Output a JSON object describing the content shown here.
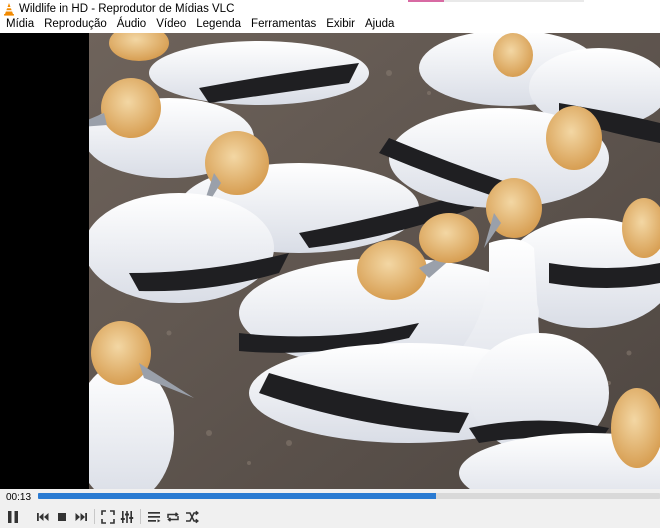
{
  "window": {
    "title": "Wildlife in HD - Reprodutor de Mídias VLC",
    "icon": "vlc-cone-icon"
  },
  "menu": [
    {
      "label": "Mídia"
    },
    {
      "label": "Reprodução"
    },
    {
      "label": "Áudio"
    },
    {
      "label": "Vídeo"
    },
    {
      "label": "Legenda"
    },
    {
      "label": "Ferramentas"
    },
    {
      "label": "Exibir"
    },
    {
      "label": "Ajuda"
    }
  ],
  "player": {
    "elapsed": "00:13",
    "progress_percent": 64
  },
  "controls": [
    {
      "name": "pause-icon"
    },
    {
      "name": "previous-icon"
    },
    {
      "name": "stop-icon"
    },
    {
      "name": "next-icon"
    },
    {
      "name": "fullscreen-icon"
    },
    {
      "name": "extended-settings-icon"
    },
    {
      "name": "playlist-icon"
    },
    {
      "name": "loop-icon"
    },
    {
      "name": "shuffle-icon"
    }
  ],
  "colors": {
    "seek_fill": "#2a7bd2",
    "vlc_orange": "#f28a00"
  }
}
